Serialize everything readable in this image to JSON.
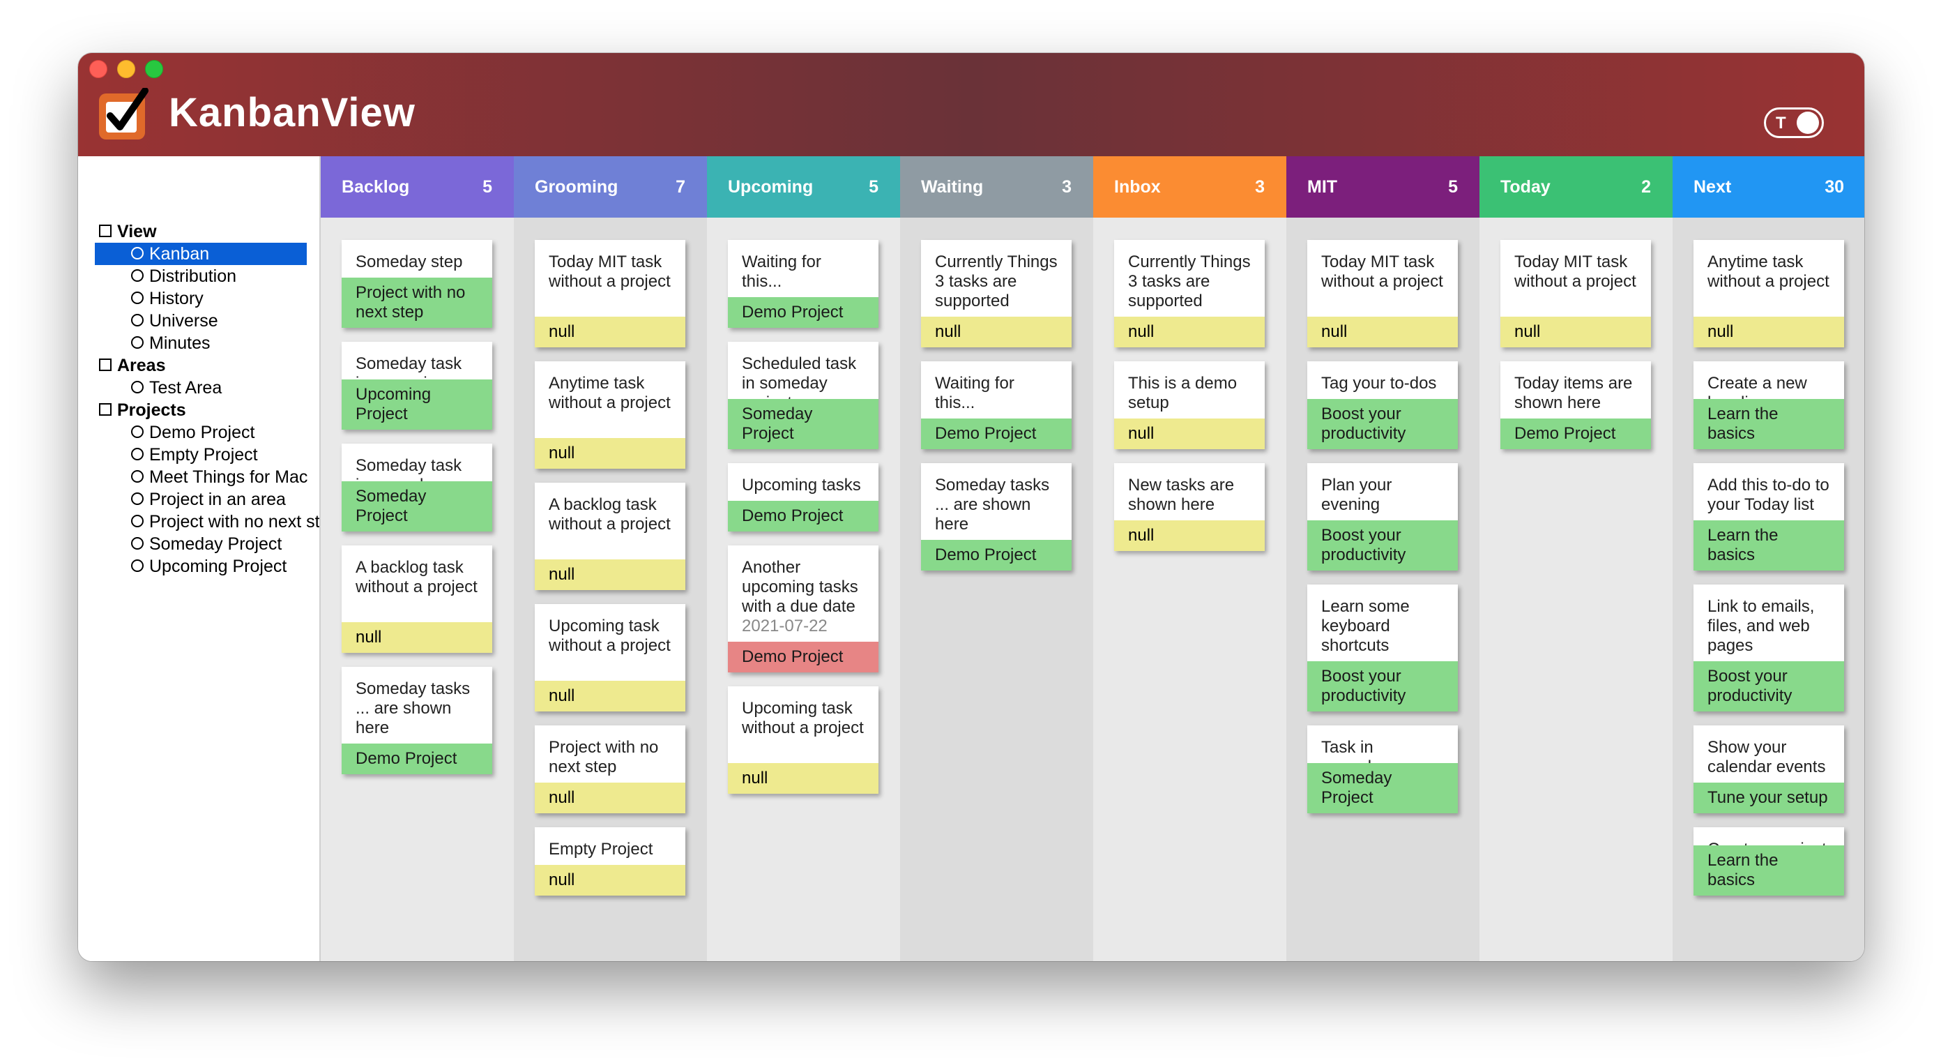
{
  "app": {
    "title": "KanbanView",
    "toggle_label": "T"
  },
  "colors": {
    "backlog": "#7b68d8",
    "grooming": "#6f80d6",
    "upcoming": "#3bb3b3",
    "waiting": "#8f9ba3",
    "inbox": "#fb8c32",
    "mit": "#7c1f7c",
    "today": "#3bc174",
    "next": "#2196f3",
    "tag_green": "#88d98b",
    "tag_yellow": "#eeea8f",
    "tag_red": "#e78585"
  },
  "sidebar": {
    "view_heading": "View",
    "view_items": [
      "Kanban",
      "Distribution",
      "History",
      "Universe",
      "Minutes"
    ],
    "areas_heading": "Areas",
    "areas_items": [
      "Test Area"
    ],
    "projects_heading": "Projects",
    "projects_items": [
      "Demo Project",
      "Empty Project",
      "Meet Things for Mac",
      "Project in an area",
      "Project with no next step",
      "Someday Project",
      "Upcoming Project"
    ]
  },
  "columns": [
    {
      "name": "Backlog",
      "count": "5",
      "cards": [
        {
          "title": "Someday step",
          "tag": "Project with no next step"
        },
        {
          "title": "Someday task in upcoming project",
          "tag": "Upcoming Project"
        },
        {
          "title": "Someday task in someday project",
          "tag": "Someday Project"
        },
        {
          "title": "A backlog task without a project",
          "tag": "null"
        },
        {
          "title": "Someday tasks ... are shown here",
          "tag": "Demo Project"
        }
      ]
    },
    {
      "name": "Grooming",
      "count": "7",
      "cards": [
        {
          "title": "Today MIT task without a project",
          "tag": "null"
        },
        {
          "title": "Anytime task without a project",
          "tag": "null"
        },
        {
          "title": "A backlog task without a project",
          "tag": "null"
        },
        {
          "title": "Upcoming task without a project",
          "tag": "null"
        },
        {
          "title": "Project with no next step",
          "tag": "null"
        },
        {
          "title": "Empty Project",
          "tag": "null"
        }
      ]
    },
    {
      "name": "Upcoming",
      "count": "5",
      "cards": [
        {
          "title": "Waiting for this...",
          "tag": "Demo Project"
        },
        {
          "title": "Scheduled task in someday project",
          "tag": "Someday Project"
        },
        {
          "title": "Upcoming tasks",
          "tag": "Demo Project"
        },
        {
          "title": "Another upcoming tasks with a due date",
          "date": "2021-07-22",
          "tag": "Demo Project"
        },
        {
          "title": "Upcoming task without a project",
          "tag": "null"
        }
      ]
    },
    {
      "name": "Waiting",
      "count": "3",
      "cards": [
        {
          "title": "Currently Things 3 tasks are supported",
          "tag": "null"
        },
        {
          "title": "Waiting for this...",
          "tag": "Demo Project"
        },
        {
          "title": "Someday tasks ... are shown here",
          "tag": "Demo Project"
        }
      ]
    },
    {
      "name": "Inbox",
      "count": "3",
      "cards": [
        {
          "title": "Currently Things 3 tasks are supported",
          "tag": "null"
        },
        {
          "title": "This is a demo setup",
          "tag": "null"
        },
        {
          "title": "New tasks are shown here",
          "tag": "null"
        }
      ]
    },
    {
      "name": "MIT",
      "count": "5",
      "cards": [
        {
          "title": "Today MIT task without a project",
          "tag": "null"
        },
        {
          "title": "Tag your to-dos",
          "tag": "Boost your productivity"
        },
        {
          "title": "Plan your evening",
          "tag": "Boost your productivity"
        },
        {
          "title": "Learn some keyboard shortcuts",
          "tag": "Boost your productivity"
        },
        {
          "title": "Task in someday project",
          "tag": "Someday Project"
        }
      ]
    },
    {
      "name": "Today",
      "count": "2",
      "cards": [
        {
          "title": "Today MIT task without a project",
          "tag": "null"
        },
        {
          "title": "Today items are shown here",
          "tag": "Demo Project"
        }
      ]
    },
    {
      "name": "Next",
      "count": "30",
      "cards": [
        {
          "title": "Anytime task without a project",
          "tag": "null"
        },
        {
          "title": "Create a new heading",
          "tag": "Learn the basics"
        },
        {
          "title": "Add this to-do to your Today list",
          "tag": "Learn the basics"
        },
        {
          "title": "Link to emails, files, and web pages",
          "tag": "Boost your productivity"
        },
        {
          "title": "Show your calendar events",
          "tag": "Tune your setup"
        },
        {
          "title": "Create a project",
          "tag": "Learn the basics"
        }
      ]
    }
  ]
}
